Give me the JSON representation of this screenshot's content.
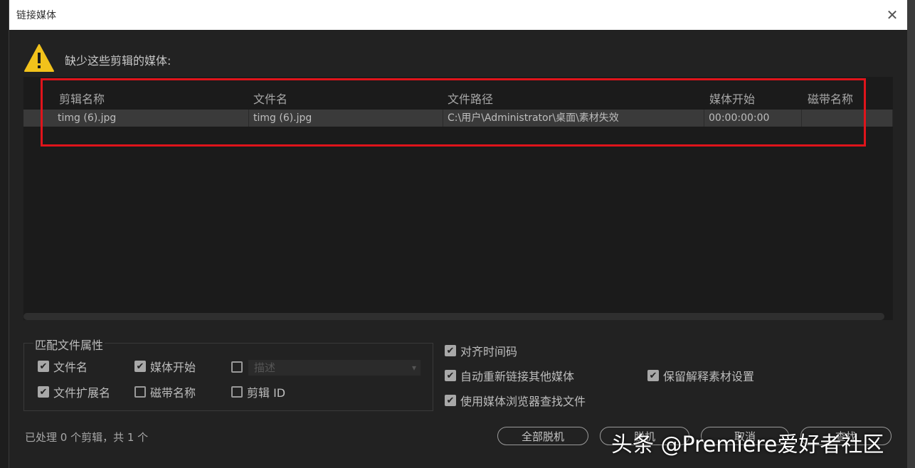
{
  "dialog": {
    "title": "链接媒体",
    "close_glyph": "✕",
    "warning_message": "缺少这些剪辑的媒体:"
  },
  "table": {
    "columns": [
      "剪辑名称",
      "文件名",
      "文件路径",
      "媒体开始",
      "磁带名称"
    ],
    "rows": [
      {
        "clip_name": "timg (6).jpg",
        "file_name": "timg (6).jpg",
        "file_path": "C:\\用户\\Administrator\\桌面\\素材失效",
        "media_start": "00:00:00:00",
        "tape_name": ""
      }
    ]
  },
  "match_properties": {
    "label": "匹配文件属性",
    "file_name": {
      "label": "文件名",
      "checked": true
    },
    "media_start": {
      "label": "媒体开始",
      "checked": true
    },
    "description": {
      "label": "描述",
      "checked": false
    },
    "file_extension": {
      "label": "文件扩展名",
      "checked": true
    },
    "tape_name": {
      "label": "磁带名称",
      "checked": false
    },
    "clip_id": {
      "label": "剪辑 ID",
      "checked": false
    }
  },
  "options": {
    "align_timecode": {
      "label": "对齐时间码",
      "checked": true
    },
    "auto_relink": {
      "label": "自动重新链接其他媒体",
      "checked": true
    },
    "use_media_browser": {
      "label": "使用媒体浏览器查找文件",
      "checked": true
    },
    "preserve_interpret": {
      "label": "保留解释素材设置",
      "checked": true
    }
  },
  "status": "已处理 0 个剪辑，共 1 个",
  "buttons": {
    "offline_all": "全部脱机",
    "offline": "脱机",
    "cancel": "取消",
    "find": "查找"
  },
  "watermark": "头条 @Premiere爱好者社区"
}
